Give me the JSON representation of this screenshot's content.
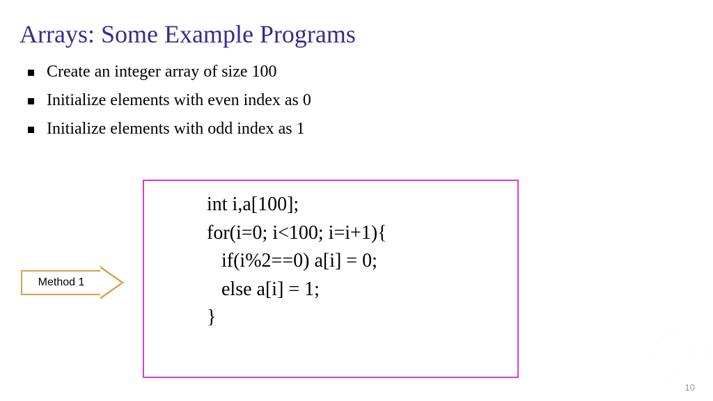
{
  "title": "Arrays: Some Example Programs",
  "bullets": [
    "Create an integer array of size 100",
    "Initialize elements with even index as 0",
    "Initialize elements with odd index as 1"
  ],
  "callout_label": "Method 1",
  "code_lines": [
    "int i,a[100];",
    "for(i=0; i<100; i=i+1){",
    "   if(i%2==0) a[i] = 0;",
    "   else a[i] = 1;",
    "}"
  ],
  "page_number": "10"
}
